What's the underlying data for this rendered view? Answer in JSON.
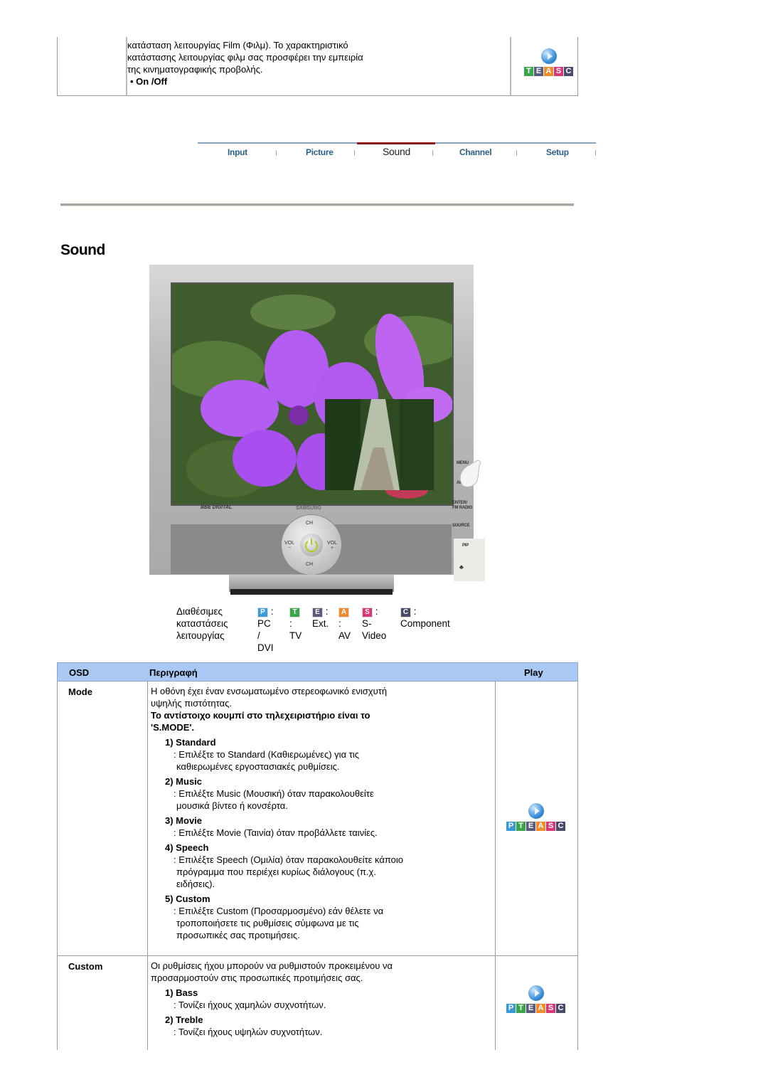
{
  "top_section": {
    "desc_lines": [
      "κατάσταση λειτουργίας Film (Φιλμ). Το χαρακτηριστικό",
      "κατάστασης λειτουργίας φιλμ σας προσφέρει την εμπειρία",
      "της κινηματογραφικής προβολής."
    ],
    "option": "• On /Off",
    "play_letters": [
      "T",
      "E",
      "A",
      "S",
      "C"
    ]
  },
  "nav": {
    "tabs": [
      {
        "label": "Input",
        "active": false
      },
      {
        "label": "Picture",
        "active": false
      },
      {
        "label": "Sound",
        "active": true
      },
      {
        "label": "Channel",
        "active": false
      },
      {
        "label": "Setup",
        "active": false
      }
    ],
    "active_color": "#8b1a1a"
  },
  "page_title": "Sound",
  "monitor": {
    "dpad": {
      "up": "CH",
      "down": "CH",
      "left": "VOL\n−",
      "right": "VOL\n+"
    },
    "side_buttons": [
      "MENU",
      "AUTO",
      "ENTER/\nFM RADIO",
      "SOURCE",
      "PIP"
    ],
    "brand": "SAMSUNG",
    "logo": "BBE DIGITAL"
  },
  "modes_legend": {
    "label_lines": [
      "Διαθέσιμες",
      "καταστάσεις",
      "λειτουργίας"
    ],
    "modes": [
      {
        "letter": "P",
        "color": "#3b9ad9",
        "name_lines": [
          "PC /",
          "DVI"
        ]
      },
      {
        "letter": "T",
        "color": "#3aa64a",
        "name_lines": [
          "TV"
        ]
      },
      {
        "letter": "E",
        "color": "#5a5a7a",
        "name_lines": [
          "Ext."
        ]
      },
      {
        "letter": "A",
        "color": "#f08a2a",
        "name_lines": [
          "AV"
        ]
      },
      {
        "letter": "S",
        "color": "#d8387a",
        "name_lines": [
          "S-",
          "Video"
        ]
      },
      {
        "letter": "C",
        "color": "#4a4a6a",
        "name_lines": [
          "Component"
        ]
      }
    ]
  },
  "table": {
    "header": {
      "osd": "OSD",
      "description": "Περιγραφή",
      "play": "Play",
      "bg_color": "#a9c9f4"
    },
    "rows": [
      {
        "osd": "Mode",
        "intro_lines": [
          "Η οθόνη έχει έναν ενσωματωμένο στερεοφωνικό ενισχυτή",
          "υψηλής πιστότητας."
        ],
        "remote_lines": [
          "Το αντίστοιχο κουμπί στο τηλεχειριστήριο είναι το",
          "'S.MODE'."
        ],
        "items": [
          {
            "title": "1) Standard",
            "desc_lines": [
              ": Επιλέξτε το Standard (Καθιερωμένες) για τις",
              "καθιερωμένες εργοστασιακές ρυθμίσεις."
            ]
          },
          {
            "title": "2) Music",
            "desc_lines": [
              ": Επιλέξτε Music (Μουσική) όταν παρακολουθείτε",
              "μουσικά βίντεο ή κονσέρτα."
            ]
          },
          {
            "title": "3) Movie",
            "desc_lines": [
              ": Επιλέξτε Movie (Ταινία) όταν προβάλλετε ταινίες."
            ]
          },
          {
            "title": "4) Speech",
            "desc_lines": [
              ": Επιλέξτε Speech (Ομιλία) όταν παρακολουθείτε κάποιο",
              "πρόγραμμα που περιέχει κυρίως διάλογους (π.χ.",
              "ειδήσεις)."
            ]
          },
          {
            "title": "5) Custom",
            "desc_lines": [
              ": Επιλέξτε Custom (Προσαρμοσμένο) εάν θέλετε να",
              "τροποποιήσετε τις ρυθμίσεις σύμφωνα με τις",
              "προσωπικές σας προτιμήσεις."
            ]
          }
        ],
        "play_letters": [
          "P",
          "T",
          "E",
          "A",
          "S",
          "C"
        ]
      },
      {
        "osd": "Custom",
        "intro_lines": [
          "Οι ρυθμίσεις ήχου μπορούν να ρυθμιστούν προκειμένου να",
          "προσαρμοστούν στις προσωπικές προτιμήσεις σας."
        ],
        "items": [
          {
            "title": "1) Bass",
            "desc_lines": [
              ": Τονίζει ήχους χαμηλών συχνοτήτων."
            ]
          },
          {
            "title": "2) Treble",
            "desc_lines": [
              ": Τονίζει ήχους υψηλών συχνοτήτων."
            ]
          }
        ],
        "play_letters": [
          "P",
          "T",
          "E",
          "A",
          "S",
          "C"
        ]
      }
    ]
  },
  "letter_colors": {
    "P": "#3b9ad9",
    "T": "#3aa64a",
    "E": "#5a5a7a",
    "A": "#f08a2a",
    "S": "#d8387a",
    "C": "#4a4a6a"
  }
}
